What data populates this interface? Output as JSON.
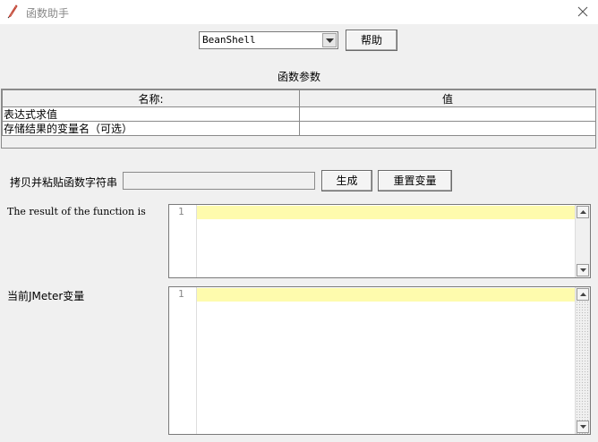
{
  "window": {
    "title": "函数助手",
    "icon": "feather-pen-icon",
    "close_icon": "close-x-icon"
  },
  "function_selector": {
    "selected": "BeanShell",
    "help_label": "帮助"
  },
  "params": {
    "section_title": "函数参数",
    "columns": [
      "名称:",
      "值"
    ],
    "rows": [
      {
        "name": "表达式求值",
        "value": ""
      },
      {
        "name": "存储结果的变量名（可选）",
        "value": ""
      }
    ]
  },
  "generate": {
    "label": "拷贝并粘贴函数字符串",
    "value": "",
    "generate_label": "生成",
    "reset_label": "重置变量"
  },
  "result": {
    "label": "The result of the function is",
    "line_number": "1",
    "content": ""
  },
  "jmeter_vars": {
    "label": "当前JMeter变量",
    "line_number": "1",
    "content": ""
  },
  "colors": {
    "highlight_line": "#fefbad",
    "window_bg": "#f0f0f0"
  }
}
